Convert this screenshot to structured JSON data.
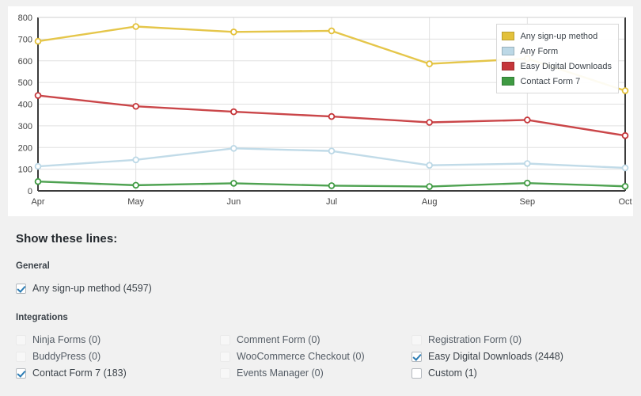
{
  "chart_data": {
    "type": "line",
    "title": "",
    "xlabel": "",
    "ylabel": "",
    "categories": [
      "Apr",
      "May",
      "Jun",
      "Jul",
      "Aug",
      "Sep",
      "Oct"
    ],
    "ylim": [
      0,
      800
    ],
    "yticks": [
      0,
      100,
      200,
      300,
      400,
      500,
      600,
      700,
      800
    ],
    "grid": true,
    "legend_position": "top-right",
    "series": [
      {
        "name": "Any sign-up method",
        "color": "#e3c13b",
        "values": [
          690,
          758,
          733,
          738,
          586,
          610,
          462
        ]
      },
      {
        "name": "Any Form",
        "color": "#bcd8e6",
        "values": [
          113,
          143,
          196,
          184,
          118,
          126,
          106
        ]
      },
      {
        "name": "Easy Digital Downloads",
        "color": "#c5363a",
        "values": [
          440,
          390,
          365,
          343,
          316,
          327,
          255
        ]
      },
      {
        "name": "Contact Form 7",
        "color": "#3f9a42",
        "values": [
          43,
          26,
          35,
          24,
          20,
          36,
          21
        ]
      }
    ]
  },
  "legend": {
    "items": [
      {
        "label": "Any sign-up method",
        "color": "#e3c13b"
      },
      {
        "label": "Any Form",
        "color": "#bcd8e6"
      },
      {
        "label": "Easy Digital Downloads",
        "color": "#c5363a"
      },
      {
        "label": "Contact Form 7",
        "color": "#3f9a42"
      }
    ]
  },
  "controls": {
    "heading": "Show these lines:",
    "general": {
      "heading": "General",
      "items": [
        {
          "label": "Any sign-up method (4597)",
          "checked": true,
          "enabled": true
        }
      ]
    },
    "integrations": {
      "heading": "Integrations",
      "column1": [
        {
          "label": "Ninja Forms (0)",
          "checked": false,
          "enabled": false
        },
        {
          "label": "BuddyPress (0)",
          "checked": false,
          "enabled": false
        },
        {
          "label": "Contact Form 7 (183)",
          "checked": true,
          "enabled": true
        }
      ],
      "column2": [
        {
          "label": "Comment Form (0)",
          "checked": false,
          "enabled": false
        },
        {
          "label": "WooCommerce Checkout (0)",
          "checked": false,
          "enabled": false
        },
        {
          "label": "Events Manager (0)",
          "checked": false,
          "enabled": false
        }
      ],
      "column3": [
        {
          "label": "Registration Form (0)",
          "checked": false,
          "enabled": false
        },
        {
          "label": "Easy Digital Downloads (2448)",
          "checked": true,
          "enabled": true
        },
        {
          "label": "Custom (1)",
          "checked": false,
          "enabled": true
        }
      ]
    }
  },
  "colors": {
    "page_background": "#f1f1f1",
    "panel_background": "#ffffff",
    "axis": "#3c3c3c",
    "grid": "#e0e0e0",
    "check_accent": "#2b7cb4"
  }
}
